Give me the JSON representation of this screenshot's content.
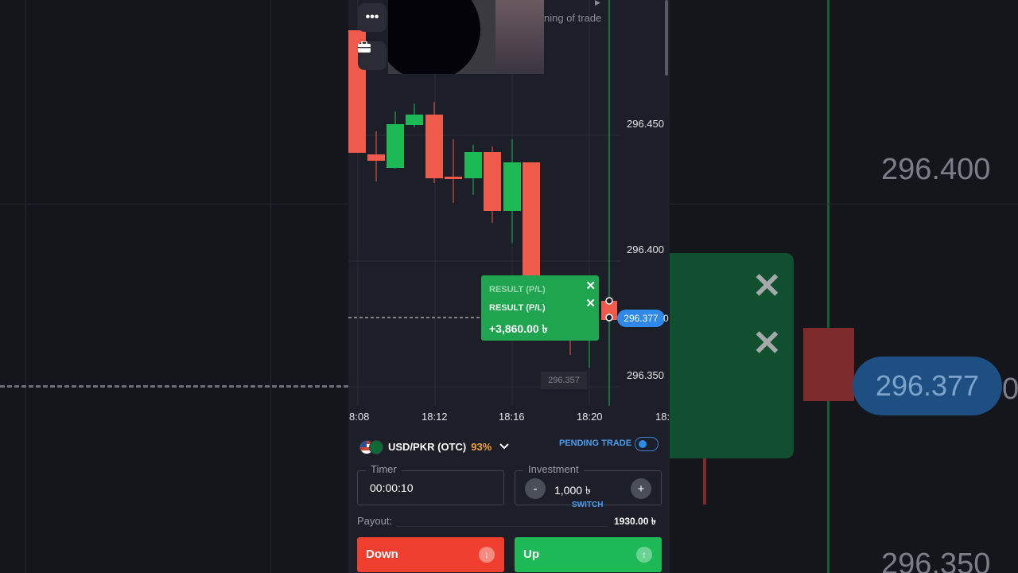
{
  "background": {
    "price_top": "296.400",
    "price_badge": "296.377",
    "price_badge_tail": "0",
    "price_bottom": "296.350"
  },
  "chart": {
    "trade_note": "ning of trade",
    "y_labels": [
      "296.450",
      "296.400",
      "296.350"
    ],
    "x_labels": [
      "8:08",
      "18:12",
      "18:16",
      "18:20",
      "18:"
    ],
    "current_price": "296.377",
    "current_price_tail": "0",
    "hover_price": "296.357",
    "colors": {
      "up": "#1db954",
      "down": "#f05a4b",
      "price_line": "#1db954"
    },
    "result_card": {
      "ghost_label": "RESULT (P/L)",
      "label": "RESULT (P/L)",
      "value": "+3,860.00 ৳",
      "close_icon": "✕"
    },
    "menu_icon": "•••",
    "briefcase_icon": "briefcase-icon"
  },
  "chart_data": {
    "type": "candlestick",
    "x": [
      "8:08",
      "18:12",
      "18:16",
      "18:20",
      "18:"
    ],
    "y_ticks": [
      296.45,
      296.4,
      296.35
    ],
    "current_price": 296.377
  },
  "controls": {
    "asset_name": "USD/PKR (OTC)",
    "asset_payout_pct": "93%",
    "pending_label": "PENDING TRADE",
    "timer_label": "Timer",
    "timer_value": "00:00:10",
    "investment_label": "Investment",
    "investment_value": "1,000 ৳",
    "minus": "-",
    "plus": "+",
    "switch_label": "SWITCH",
    "payout_label": "Payout:",
    "payout_value": "1930.00 ৳",
    "down_label": "Down",
    "up_label": "Up",
    "down_arrow": "↓",
    "up_arrow": "↑"
  }
}
